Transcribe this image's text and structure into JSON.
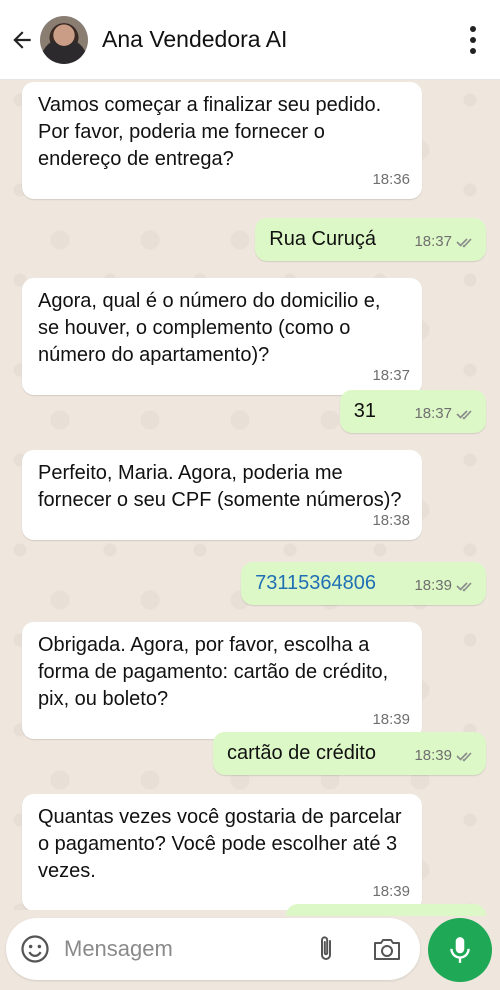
{
  "header": {
    "title": "Ana Vendedora AI",
    "avatar": "contact-avatar"
  },
  "icons": {
    "back": "arrow-back-icon",
    "menu": "more-vertical-icon"
  },
  "messages": [
    {
      "dir": "in",
      "text": "Vamos começar a finalizar seu pedido. Por favor, poderia me fornecer o endereço de entrega?",
      "time": "18:36"
    },
    {
      "dir": "out",
      "text": "Rua Curuçá",
      "time": "18:37"
    },
    {
      "dir": "in",
      "text": "Agora, qual é o número do domicilio e, se houver, o complemento (como o número do apartamento)?",
      "time": "18:37"
    },
    {
      "dir": "out",
      "text": "31",
      "time": "18:37"
    },
    {
      "dir": "in",
      "text": "Perfeito, Maria. Agora, poderia me fornecer o seu CPF (somente números)?",
      "time": "18:38"
    },
    {
      "dir": "out",
      "text": "73115364806",
      "time": "18:39"
    },
    {
      "dir": "in",
      "text": "Obrigada. Agora, por favor, escolha a forma de pagamento: cartão de crédito, pix, ou boleto?",
      "time": "18:39"
    },
    {
      "dir": "out",
      "text": "cartão de crédito",
      "time": "18:39"
    },
    {
      "dir": "in",
      "text": "Quantas vezes você gostaria de parcelar o pagamento? Você pode escolher até 3 vezes.",
      "time": "18:39"
    }
  ],
  "input": {
    "placeholder": "Mensagem"
  },
  "colors": {
    "accent": "#1fa855",
    "outgoing": "#dcf8c6",
    "incoming": "#ffffff",
    "background": "#efe7de",
    "link": "#1f6fb5"
  }
}
